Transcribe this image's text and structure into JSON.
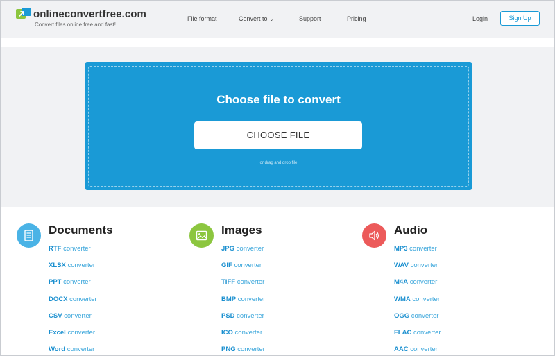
{
  "header": {
    "brand": "onlineconvertfree.com",
    "tagline": "Convert files online free and fast!",
    "nav": [
      {
        "label": "File format",
        "has_dropdown": false
      },
      {
        "label": "Convert to",
        "has_dropdown": true
      },
      {
        "label": "Support",
        "has_dropdown": false
      },
      {
        "label": "Pricing",
        "has_dropdown": false
      }
    ],
    "login_label": "Login",
    "signup_label": "Sign Up"
  },
  "upload": {
    "title": "Choose file to convert",
    "button_label": "CHOOSE FILE",
    "hint": "or drag and drop file"
  },
  "categories": [
    {
      "title": "Documents",
      "icon": "document-icon",
      "color": "#4ab3e6",
      "links": [
        {
          "format": "RTF",
          "suffix": " converter"
        },
        {
          "format": "XLSX",
          "suffix": " converter"
        },
        {
          "format": "PPT",
          "suffix": " converter"
        },
        {
          "format": "DOCX",
          "suffix": " converter"
        },
        {
          "format": "CSV",
          "suffix": " converter"
        },
        {
          "format": "Excel",
          "suffix": " converter"
        },
        {
          "format": "Word",
          "suffix": " converter"
        }
      ]
    },
    {
      "title": "Images",
      "icon": "image-icon",
      "color": "#8cc63f",
      "links": [
        {
          "format": "JPG",
          "suffix": " converter"
        },
        {
          "format": "GIF",
          "suffix": " converter"
        },
        {
          "format": "TIFF",
          "suffix": " converter"
        },
        {
          "format": "BMP",
          "suffix": " converter"
        },
        {
          "format": "PSD",
          "suffix": " converter"
        },
        {
          "format": "ICO",
          "suffix": " converter"
        },
        {
          "format": "PNG",
          "suffix": " converter"
        }
      ]
    },
    {
      "title": "Audio",
      "icon": "speaker-icon",
      "color": "#ec5a5a",
      "links": [
        {
          "format": "MP3",
          "suffix": " converter"
        },
        {
          "format": "WAV",
          "suffix": " converter"
        },
        {
          "format": "M4A",
          "suffix": " converter"
        },
        {
          "format": "WMA",
          "suffix": " converter"
        },
        {
          "format": "OGG",
          "suffix": " converter"
        },
        {
          "format": "FLAC",
          "suffix": " converter"
        },
        {
          "format": "AAC",
          "suffix": " converter"
        }
      ]
    }
  ],
  "colors": {
    "accent": "#1a9ad6",
    "link": "#1a8fcf",
    "page_bg": "#f1f2f4"
  }
}
